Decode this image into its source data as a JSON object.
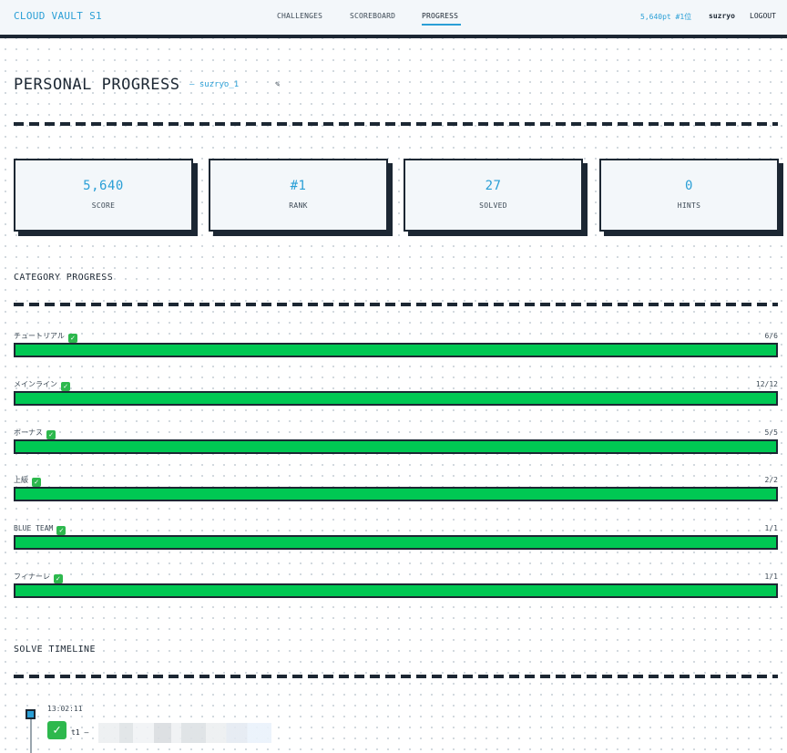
{
  "header": {
    "brand": "CLOUD VAULT S1",
    "nav": [
      {
        "label": "CHALLENGES",
        "active": false
      },
      {
        "label": "SCOREBOARD",
        "active": false
      },
      {
        "label": "PROGRESS",
        "active": true
      }
    ],
    "user_score": "5,640pt #1位",
    "user_name": "suzryo",
    "logout_label": "LOGOUT"
  },
  "page": {
    "title": "PERSONAL PROGRESS",
    "user_link": "— suzryo_1",
    "edit_icon": "✎"
  },
  "stats": [
    {
      "value": "5,640",
      "label": "SCORE"
    },
    {
      "value": "#1",
      "label": "RANK"
    },
    {
      "value": "27",
      "label": "SOLVED"
    },
    {
      "value": "0",
      "label": "HINTS"
    }
  ],
  "category_section": {
    "title": "CATEGORY PROGRESS",
    "categories": [
      {
        "label": "チュートリアル",
        "count": "6/6",
        "progress": 1.0
      },
      {
        "label": "メインライン",
        "count": "12/12",
        "progress": 1.0
      },
      {
        "label": "ボーナス",
        "count": "5/5",
        "progress": 1.0
      },
      {
        "label": "上級",
        "count": "2/2",
        "progress": 1.0
      },
      {
        "label": "BLUE TEAM",
        "count": "1/1",
        "progress": 1.0
      },
      {
        "label": "フィナーレ",
        "count": "1/1",
        "progress": 1.0
      }
    ]
  },
  "timeline": {
    "title": "SOLVE TIMELINE",
    "entries": [
      {
        "time": "13:02:11",
        "name": "t1 —"
      }
    ]
  },
  "colors": {
    "accent": "#2a9fd6",
    "ink": "#1c2733",
    "progress_fill": "#00c853",
    "check": "#2db84d"
  }
}
